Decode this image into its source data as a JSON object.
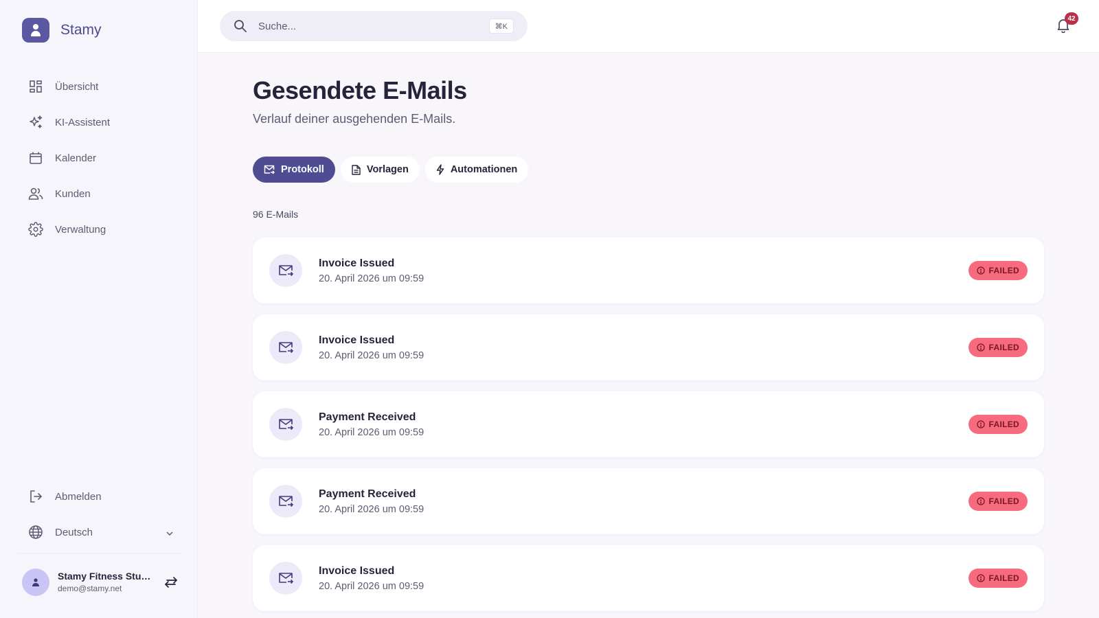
{
  "brand": {
    "name": "Stamy"
  },
  "sidebar": {
    "items": [
      {
        "label": "Übersicht",
        "icon": "dashboard-icon"
      },
      {
        "label": "KI-Assistent",
        "icon": "sparkles-icon"
      },
      {
        "label": "Kalender",
        "icon": "calendar-icon"
      },
      {
        "label": "Kunden",
        "icon": "users-icon"
      },
      {
        "label": "Verwaltung",
        "icon": "gear-icon"
      }
    ],
    "logout_label": "Abmelden",
    "language_label": "Deutsch",
    "user": {
      "name": "Stamy Fitness Studio",
      "email": "demo@stamy.net"
    }
  },
  "topbar": {
    "search_placeholder": "Suche...",
    "search_shortcut": "⌘K",
    "notification_count": "42"
  },
  "main": {
    "title": "Gesendete E-Mails",
    "subtitle": "Verlauf deiner ausgehenden E-Mails.",
    "tabs": [
      {
        "label": "Protokoll",
        "active": true
      },
      {
        "label": "Vorlagen",
        "active": false
      },
      {
        "label": "Automationen",
        "active": false
      }
    ],
    "count_label": "96 E-Mails",
    "emails": [
      {
        "title": "Invoice Issued",
        "date": "20. April 2026 um 09:59",
        "status": "FAILED"
      },
      {
        "title": "Invoice Issued",
        "date": "20. April 2026 um 09:59",
        "status": "FAILED"
      },
      {
        "title": "Payment Received",
        "date": "20. April 2026 um 09:59",
        "status": "FAILED"
      },
      {
        "title": "Payment Received",
        "date": "20. April 2026 um 09:59",
        "status": "FAILED"
      },
      {
        "title": "Invoice Issued",
        "date": "20. April 2026 um 09:59",
        "status": "FAILED"
      }
    ]
  },
  "colors": {
    "brand": "#5b57a0",
    "active_tab": "#504c92",
    "failed_badge": "#f76b7f",
    "failed_text": "#7d1428",
    "notification_badge": "#b8304a"
  }
}
